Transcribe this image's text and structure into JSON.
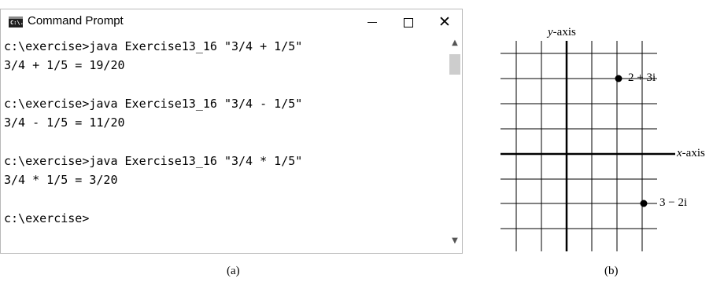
{
  "window": {
    "title": "Command Prompt",
    "icon": "command-prompt-icon",
    "icon_text": "C:\\.",
    "controls": {
      "minimize": "minimize-icon",
      "maximize": "maximize-icon",
      "close": "close-icon"
    }
  },
  "console": {
    "lines": [
      "c:\\exercise>java Exercise13_16 \"3/4 + 1/5\"",
      "3/4 + 1/5 = 19/20",
      "",
      "c:\\exercise>java Exercise13_16 \"3/4 - 1/5\"",
      "3/4 - 1/5 = 11/20",
      "",
      "c:\\exercise>java Exercise13_16 \"3/4 * 1/5\"",
      "3/4 * 1/5 = 3/20",
      "",
      "c:\\exercise>"
    ]
  },
  "scrollbar": {
    "up": "▲",
    "down": "▼"
  },
  "captions": {
    "a": "(a)",
    "b": "(b)"
  },
  "plane": {
    "y_axis_var": "y",
    "y_axis_rest": "-axis",
    "x_axis_var": "x",
    "x_axis_rest": "-axis",
    "points": [
      {
        "label": "2 + 3i",
        "re": 2,
        "im": 3
      },
      {
        "label": "3 − 2i",
        "re": 3,
        "im": -2
      }
    ]
  }
}
